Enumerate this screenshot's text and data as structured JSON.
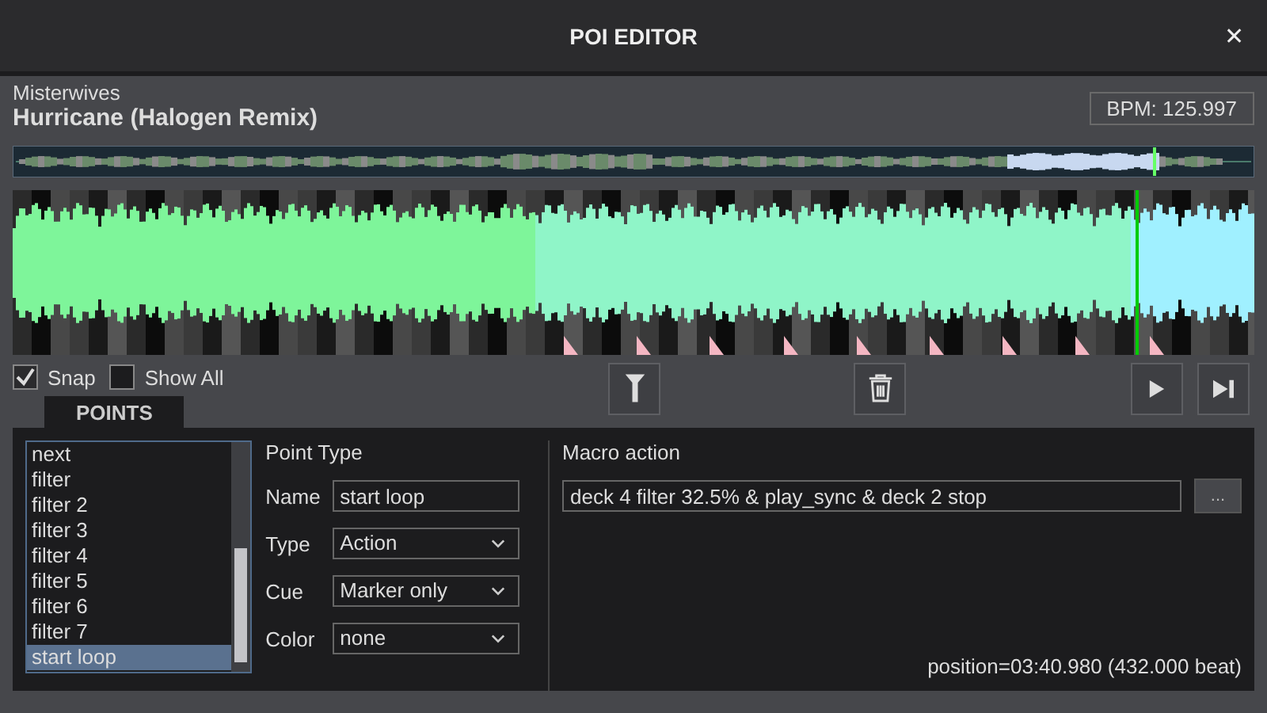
{
  "window": {
    "title": "POI EDITOR",
    "close": "✕"
  },
  "track": {
    "artist": "Misterwives",
    "title": "Hurricane (Halogen Remix)",
    "bpm": "BPM: 125.997"
  },
  "options": [
    {
      "label": "Snap",
      "checked": true
    },
    {
      "label": "Show All",
      "checked": false
    }
  ],
  "tabs": [
    {
      "label": "POINTS",
      "selected": true
    }
  ],
  "points": [
    {
      "label": "next",
      "selected": false
    },
    {
      "label": "filter",
      "selected": false
    },
    {
      "label": "filter 2",
      "selected": false
    },
    {
      "label": "filter 3",
      "selected": false
    },
    {
      "label": "filter 4",
      "selected": false
    },
    {
      "label": "filter 5",
      "selected": false
    },
    {
      "label": "filter 6",
      "selected": false
    },
    {
      "label": "filter 7",
      "selected": false
    },
    {
      "label": "start loop",
      "selected": true
    }
  ],
  "point_type": {
    "heading": "Point Type",
    "fields": [
      {
        "kind": "text",
        "label": "Name",
        "value": "start loop"
      },
      {
        "kind": "select",
        "label": "Type",
        "value": "Action"
      },
      {
        "kind": "select",
        "label": "Cue",
        "value": "Marker only"
      },
      {
        "kind": "select",
        "label": "Color",
        "value": "none"
      }
    ]
  },
  "macro": {
    "heading": "Macro action",
    "value": "deck 4 filter 32.5% & play_sync & deck 2 stop",
    "browse": "..."
  },
  "status": "position=03:40.980 (432.000 beat)"
}
